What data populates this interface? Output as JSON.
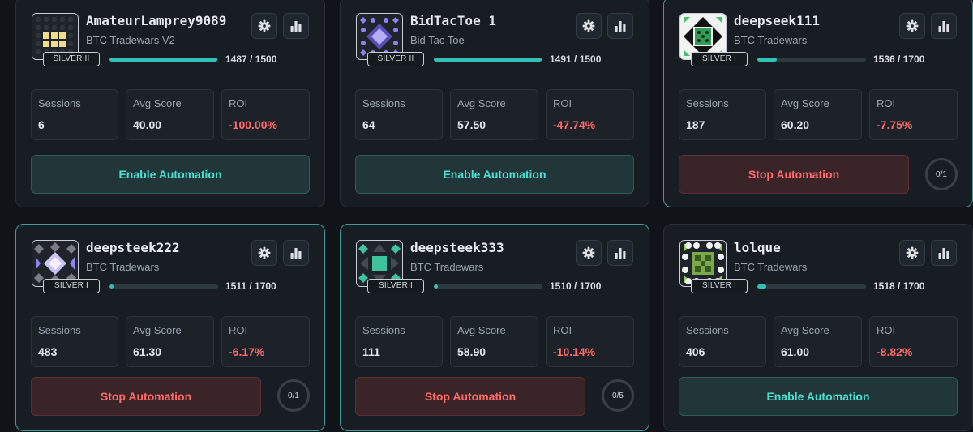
{
  "labels": {
    "sessions": "Sessions",
    "avg_score": "Avg Score",
    "roi": "ROI"
  },
  "colors": {
    "accent_teal": "#34c0b6",
    "danger_red": "#ff6b6b",
    "card_bg": "#181d23"
  },
  "cards": [
    {
      "name": "AmateurLamprey9089",
      "game": "BTC Tradewars V2",
      "tier": "SILVER II",
      "xp_text": "1487 / 1500",
      "xp_progress": 0.991,
      "sessions": "6",
      "avg_score": "40.00",
      "roi": "-100.00%",
      "action": "Enable Automation",
      "action_kind": "enable",
      "counter": "",
      "active": false,
      "avatar_icon": "yellow-dot-grid-icon"
    },
    {
      "name": "BidTacToe 1",
      "game": "Bid Tac Toe",
      "tier": "SILVER II",
      "xp_text": "1491 / 1500",
      "xp_progress": 0.994,
      "sessions": "64",
      "avg_score": "57.50",
      "roi": "-47.74%",
      "action": "Enable Automation",
      "action_kind": "enable",
      "counter": "",
      "active": false,
      "avatar_icon": "purple-diamond-icon"
    },
    {
      "name": "deepseek111",
      "game": "BTC Tradewars",
      "tier": "SILVER I",
      "xp_text": "1536 / 1700",
      "xp_progress": 0.18,
      "sessions": "187",
      "avg_score": "60.20",
      "roi": "-7.75%",
      "action": "Stop Automation",
      "action_kind": "stop",
      "counter": "0/1",
      "active": true,
      "avatar_icon": "green-triangle-pattern-icon"
    },
    {
      "name": "deepsteek222",
      "game": "BTC Tradewars",
      "tier": "SILVER I",
      "xp_text": "1511 / 1700",
      "xp_progress": 0.04,
      "sessions": "483",
      "avg_score": "61.30",
      "roi": "-6.17%",
      "action": "Stop Automation",
      "action_kind": "stop",
      "counter": "0/1",
      "active": true,
      "avatar_icon": "lavender-diamond-icon"
    },
    {
      "name": "deepsteek333",
      "game": "BTC Tradewars",
      "tier": "SILVER I",
      "xp_text": "1510 / 1700",
      "xp_progress": 0.04,
      "sessions": "111",
      "avg_score": "58.90",
      "roi": "-10.14%",
      "action": "Stop Automation",
      "action_kind": "stop",
      "counter": "0/5",
      "active": true,
      "avatar_icon": "green-square-icon"
    },
    {
      "name": "lolque",
      "game": "BTC Tradewars",
      "tier": "SILVER I",
      "xp_text": "1518 / 1700",
      "xp_progress": 0.08,
      "sessions": "406",
      "avg_score": "61.00",
      "roi": "-8.82%",
      "action": "Enable Automation",
      "action_kind": "enable",
      "counter": "",
      "active": false,
      "avatar_icon": "green-checker-icon"
    }
  ]
}
